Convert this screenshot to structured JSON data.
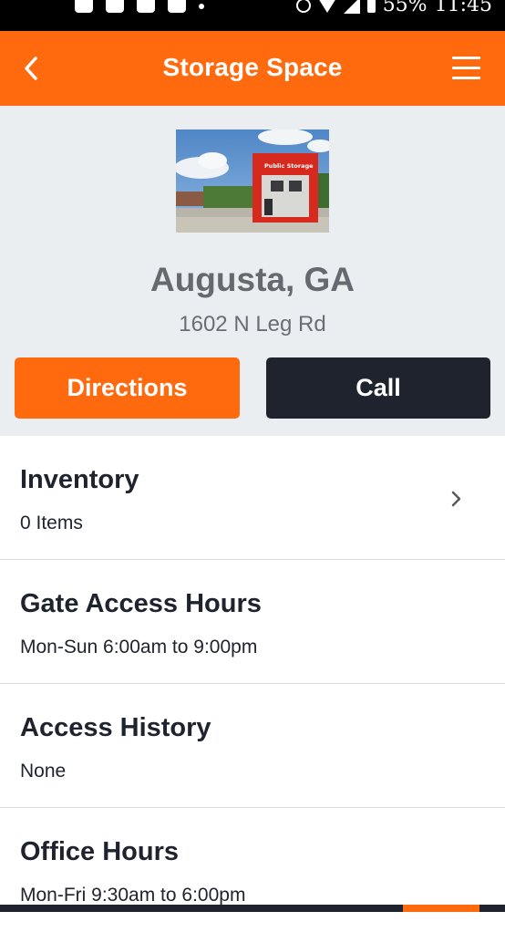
{
  "status_bar": {
    "battery": "55%",
    "time": "11:45"
  },
  "header": {
    "title": "Storage Space",
    "back_icon": "chevron-left-icon",
    "menu_icon": "hamburger-menu-icon"
  },
  "location": {
    "photo_sign": "Public Storage",
    "city": "Augusta, GA",
    "address": "1602 N Leg Rd"
  },
  "actions": {
    "directions_label": "Directions",
    "call_label": "Call"
  },
  "info": [
    {
      "title": "Inventory",
      "value": "0 Items"
    },
    {
      "title": "Gate Access Hours",
      "value": "Mon-Sun 6:00am to 9:00pm"
    },
    {
      "title": "Access History",
      "value": "None"
    },
    {
      "title": "Office Hours",
      "value": "Mon-Fri 9:30am to 6:00pm"
    }
  ],
  "colors": {
    "brand_orange": "#FF6A0E",
    "dark_navy": "#1E232E",
    "panel_gray": "#EBEEF1"
  }
}
